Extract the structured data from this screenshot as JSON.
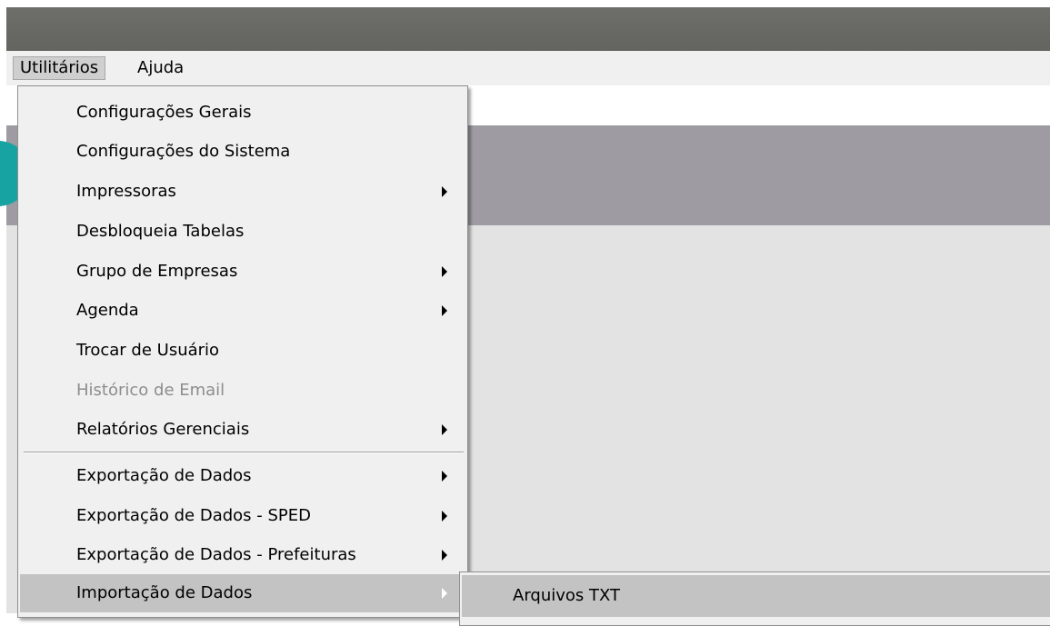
{
  "menubar": {
    "items": [
      {
        "label": "Utilitários"
      },
      {
        "label": "Ajuda"
      }
    ]
  },
  "dropdown": {
    "items": [
      {
        "label": "Configurações Gerais"
      },
      {
        "label": "Configurações do Sistema"
      },
      {
        "label": "Impressoras"
      },
      {
        "label": "Desbloqueia Tabelas"
      },
      {
        "label": "Grupo de Empresas"
      },
      {
        "label": "Agenda"
      },
      {
        "label": "Trocar de Usuário"
      },
      {
        "label": "Histórico de Email"
      },
      {
        "label": "Relatórios Gerenciais"
      },
      {
        "label": "Exportação de Dados"
      },
      {
        "label": "Exportação de Dados - SPED"
      },
      {
        "label": "Exportação de Dados - Prefeituras"
      },
      {
        "label": "Importação de Dados"
      }
    ]
  },
  "submenu": {
    "items": [
      {
        "label": "Arquivos TXT"
      }
    ]
  }
}
